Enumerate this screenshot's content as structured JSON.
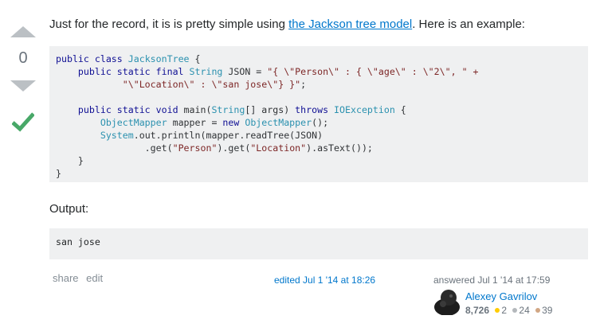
{
  "vote": {
    "count": "0"
  },
  "answer": {
    "intro_before": "Just for the record, it is is pretty simple using ",
    "intro_link": "the Jackson tree model",
    "intro_after": ". Here is an example:",
    "output_label": "Output:",
    "output_code": "san jose"
  },
  "code": {
    "l1": [
      "public class ",
      "JacksonTree",
      " {"
    ],
    "l2": [
      "    public static final ",
      "String",
      " JSON = ",
      "\"{ \\\"Person\\\" : { \\\"age\\\" : \\\"2\\\", \" +"
    ],
    "l3": [
      "            ",
      "\"\\\"Location\\\" : \\\"san jose\\\"} }\"",
      ";"
    ],
    "l5": [
      "    public static void ",
      "main(",
      "String",
      "[] args) ",
      "throws ",
      "IOException",
      " {"
    ],
    "l6": [
      "        ",
      "ObjectMapper",
      " mapper = ",
      "new ",
      "ObjectMapper",
      "();"
    ],
    "l7": [
      "        ",
      "System",
      ".out.println(mapper.readTree(JSON)"
    ],
    "l8": [
      "                .get(",
      "\"Person\"",
      ").get(",
      "\"Location\"",
      ").asText());"
    ],
    "l9": "    }",
    "l10": "}"
  },
  "footer": {
    "share": "share",
    "edit": "edit",
    "edited": "edited Jul 1 '14 at 18:26",
    "answered": "answered Jul 1 '14 at 17:59",
    "user_name": "Alexey Gavrilov",
    "reputation": "8,726",
    "gold": "2",
    "silver": "24",
    "bronze": "39"
  },
  "colors": {
    "gold": "#ffcc01",
    "silver": "#b4b8bc",
    "bronze": "#d1a684",
    "accepted": "#48a868"
  }
}
